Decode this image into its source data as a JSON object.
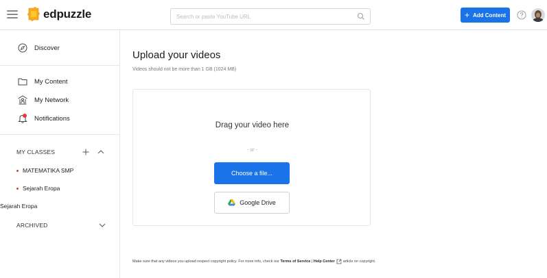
{
  "app": {
    "brand": "edpuzzle"
  },
  "search": {
    "placeholder": "Search or paste YouTube URL"
  },
  "header": {
    "add_content_label": "Add Content"
  },
  "sidebar": {
    "discover": "Discover",
    "my_content": "My Content",
    "my_network": "My Network",
    "notifications": "Notifications",
    "my_classes_heading": "MY CLASSES",
    "classes": [
      "MATEMATIKA SMP",
      "Sejarah Eropa"
    ],
    "extra_class": "Sejarah Eropa",
    "archived_heading": "ARCHIVED"
  },
  "main": {
    "title": "Upload your videos",
    "subtitle": "Videos should not be more than 1 GB (1024 MB)",
    "drag_text": "Drag your video here",
    "or_text": "- or -",
    "choose_file_label": "Choose a file...",
    "google_drive_label": "Google Drive"
  },
  "footer": {
    "text_before": "Make sure that any videos you upload respect copyright policy. For more info, check our",
    "terms_link": "Terms of Service",
    "separator": "|",
    "help_link": "Help Center",
    "text_after": "article on copyright."
  },
  "colors": {
    "accent": "#1a73e8",
    "class_dot": "#e53935"
  },
  "icons": [
    "menu-icon",
    "edpuzzle-logo",
    "search-icon",
    "plus-icon",
    "help-icon",
    "avatar",
    "compass-icon",
    "folder-icon",
    "network-icon",
    "bell-icon",
    "chevron-up-icon",
    "chevron-down-icon",
    "google-drive-icon",
    "external-link-icon"
  ]
}
